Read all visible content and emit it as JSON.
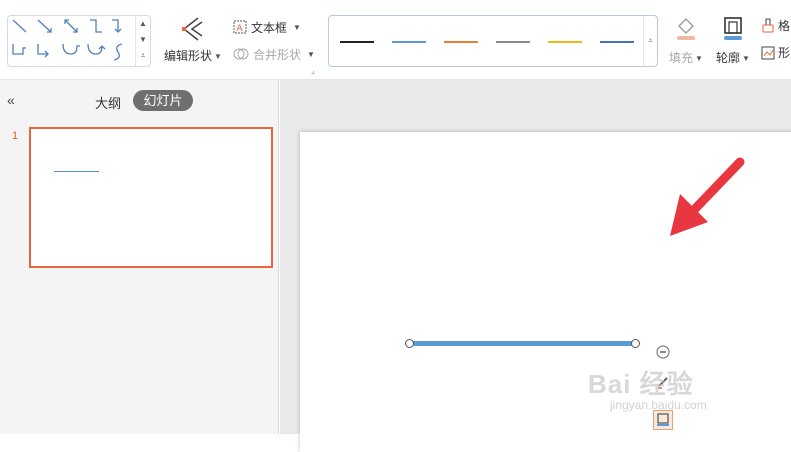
{
  "ribbon": {
    "edit_shape_label": "编辑形状",
    "textbox_label": "文本框",
    "merge_shapes_label": "合并形状",
    "fill_label": "填充",
    "outline_label": "轮廓",
    "format_painter_label": "格",
    "shape_effect_label": "形",
    "line_styles": [
      {
        "color": "#222222"
      },
      {
        "color": "#5b9bd5"
      },
      {
        "color": "#ed7d31"
      },
      {
        "color": "#8a8a8a"
      },
      {
        "color": "#f2b619"
      },
      {
        "color": "#4472c4"
      }
    ]
  },
  "left_panel": {
    "collapse_glyph": "«",
    "tab_outline": "大纲",
    "tab_slides": "幻灯片",
    "slide_number": "1"
  },
  "canvas": {
    "line_color": "#5b9bd5",
    "annotation_color": "#e8373f"
  },
  "watermark": {
    "logo_text": "Bai 经验",
    "url": "jingyan.baidu.com"
  },
  "colors": {
    "accent": "#e8663d",
    "tab_active_bg": "#6f6f6f"
  }
}
